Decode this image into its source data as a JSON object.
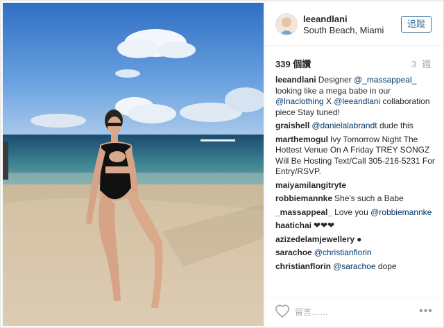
{
  "post": {
    "username": "leeandlani",
    "location": "South Beach, Miami",
    "follow_label": "追蹤",
    "likes": "339 個讚",
    "time_ago": "3 週",
    "photo_description_icon": "beach-photo"
  },
  "comments": [
    {
      "user": "leeandlani",
      "parts": [
        "Designer ",
        "@_massappeal_",
        " looking like a mega babe in our ",
        "@lnaclothing",
        " X ",
        "@leeandlani",
        " collaboration piece ",
        "",
        " Stay tuned!"
      ]
    },
    {
      "user": "graishell",
      "parts": [
        "",
        "@danielalabrandt",
        " dude this"
      ]
    },
    {
      "user": "marthemogul",
      "parts": [
        "Ivy Tomorrow Night The Hottest Venue On A Friday ",
        "",
        " TREY SONGZ Will Be Hosting ",
        "",
        " Text/Call 305-216-5231 For Entry/RSVP."
      ]
    },
    {
      "user": "maiyamilangitryte",
      "parts": [
        "",
        "",
        ""
      ]
    },
    {
      "user": "robbiemannke",
      "parts": [
        "She's such a Babe"
      ]
    },
    {
      "user": "_massappeal_",
      "parts": [
        "Love you ",
        "",
        " ",
        "@robbiemannke"
      ]
    },
    {
      "user": "haatichai",
      "parts": [
        "❤❤❤"
      ]
    },
    {
      "user": "azizedelamjewellery",
      "parts": [
        "●"
      ]
    },
    {
      "user": "sarachoe",
      "parts": [
        "",
        "@christianflorin"
      ]
    },
    {
      "user": "christianflorin",
      "parts": [
        "",
        "@sarachoe",
        " dope"
      ]
    }
  ],
  "comment_box": {
    "placeholder": "留言……",
    "more_label": "•••"
  },
  "icons": {
    "like": "heart-outline-icon",
    "more": "ellipsis-icon"
  },
  "colors": {
    "mention": "#003569",
    "follow": "#3f729b",
    "muted": "#a5a7aa"
  }
}
